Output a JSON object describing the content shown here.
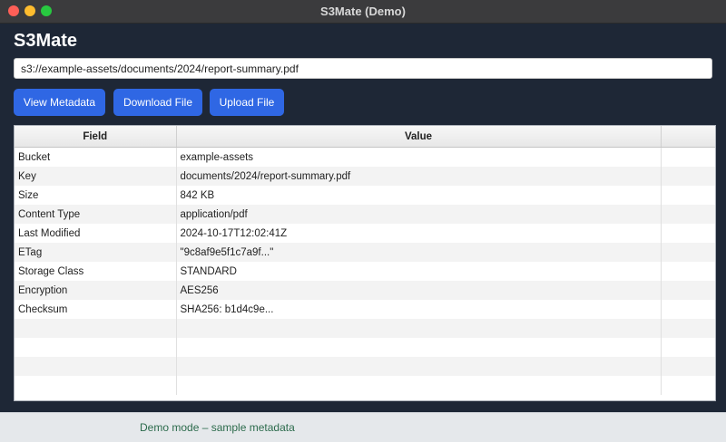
{
  "window": {
    "title": "S3Mate (Demo)",
    "controls": [
      "close-icon",
      "minimize-icon",
      "maximize-icon"
    ],
    "control_colors": {
      "close": "#ff5f57",
      "minimize": "#febc2e",
      "maximize": "#28c840"
    }
  },
  "app": {
    "title": "S3Mate"
  },
  "path_input": {
    "value": "s3://example-assets/documents/2024/report-summary.pdf"
  },
  "toolbar": {
    "view_label": "View Metadata",
    "download_label": "Download File",
    "upload_label": "Upload File",
    "accent_color": "#2f67e4"
  },
  "table": {
    "headers": [
      "Field",
      "Value",
      ""
    ],
    "rows": [
      {
        "field": "Bucket",
        "value": "example-assets"
      },
      {
        "field": "Key",
        "value": "documents/2024/report-summary.pdf"
      },
      {
        "field": "Size",
        "value": "842 KB"
      },
      {
        "field": "Content Type",
        "value": "application/pdf"
      },
      {
        "field": "Last Modified",
        "value": "2024-10-17T12:02:41Z"
      },
      {
        "field": "ETag",
        "value": "\"9c8af9e5f1c7a9f...\""
      },
      {
        "field": "Storage Class",
        "value": "STANDARD"
      },
      {
        "field": "Encryption",
        "value": "AES256"
      },
      {
        "field": "Checksum",
        "value": "SHA256: b1d4c9e..."
      },
      {
        "field": "",
        "value": ""
      },
      {
        "field": "",
        "value": ""
      },
      {
        "field": "",
        "value": ""
      },
      {
        "field": "",
        "value": ""
      }
    ]
  },
  "status": {
    "text": "Demo mode – sample metadata",
    "color": "#2c6b4c"
  }
}
